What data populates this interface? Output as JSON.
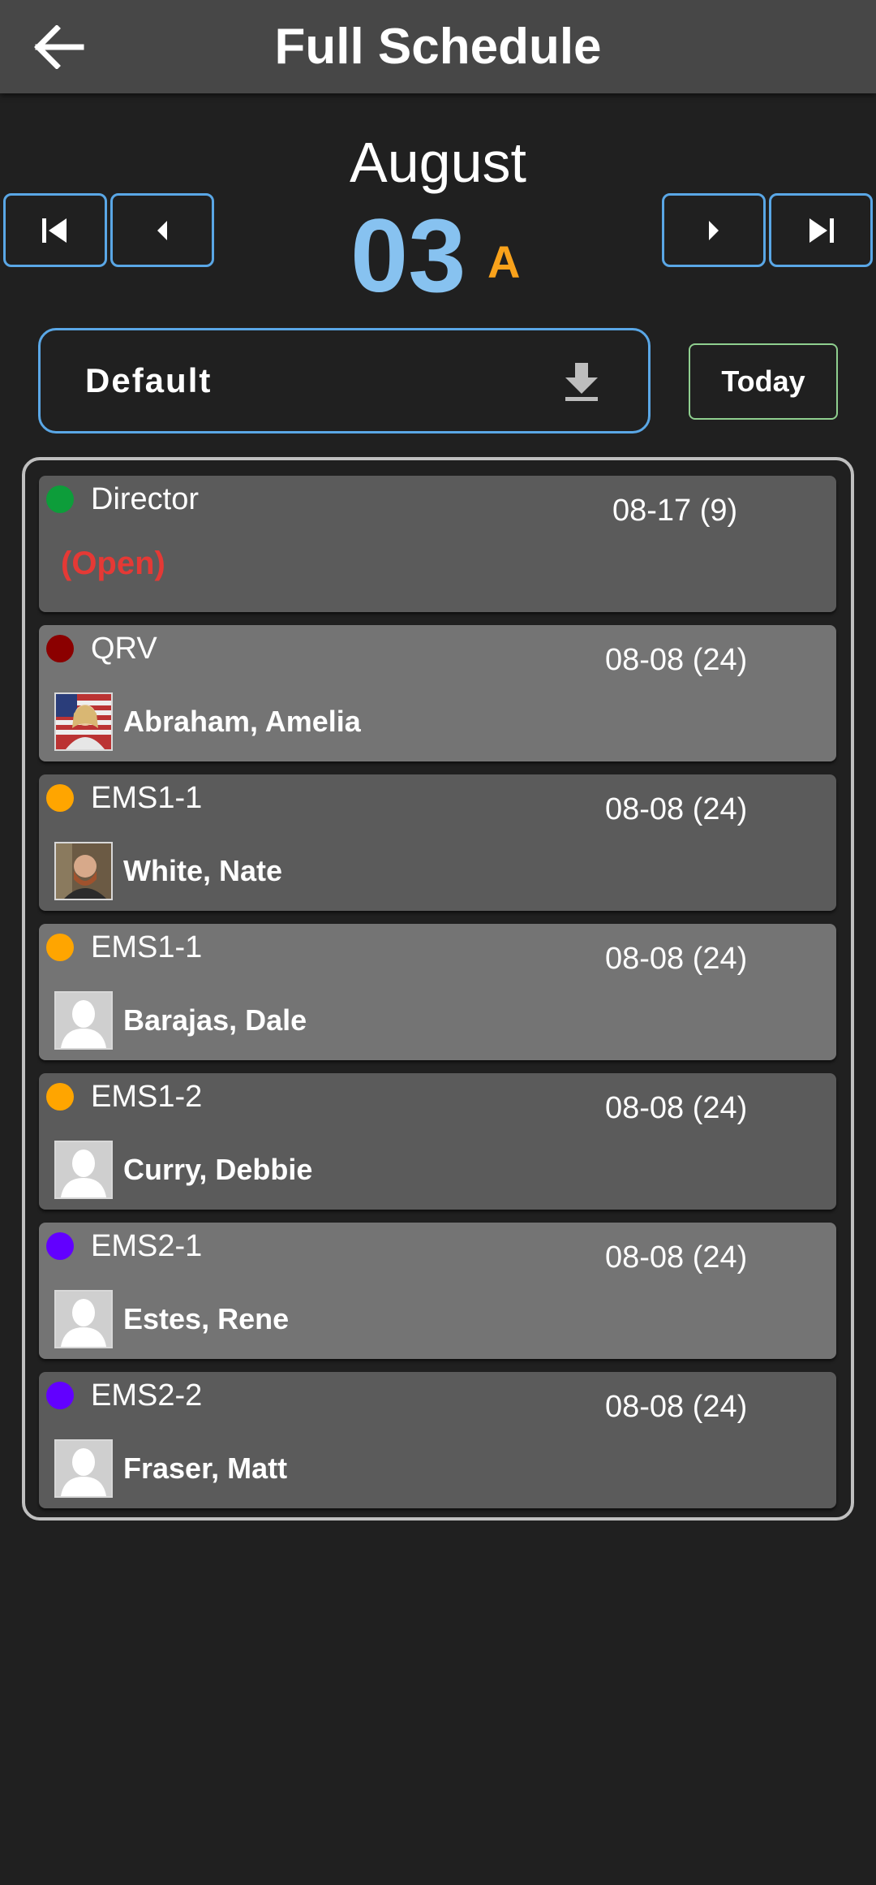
{
  "header": {
    "title": "Full Schedule"
  },
  "date": {
    "month": "August",
    "day": "03",
    "shift_letter": "A"
  },
  "profile": {
    "label": "Default"
  },
  "today_label": "Today",
  "colors": {
    "director": "#0d9d3a",
    "qrv": "#8b0000",
    "ems1": "#ffa500",
    "ems2": "#6200ff"
  },
  "shifts": [
    {
      "position": "Director",
      "time": "08-17 (9)",
      "status": "(Open)",
      "dot_color": "#0d9d3a",
      "avatar": "none"
    },
    {
      "position": "QRV",
      "time": "08-08 (24)",
      "name": "Abraham, Amelia",
      "dot_color": "#8b0000",
      "avatar": "photo-flag"
    },
    {
      "position": "EMS1-1",
      "time": "08-08 (24)",
      "name": "White, Nate",
      "dot_color": "#ffa500",
      "avatar": "photo-man"
    },
    {
      "position": "EMS1-1",
      "time": "08-08 (24)",
      "name": "Barajas, Dale",
      "dot_color": "#ffa500",
      "avatar": "placeholder"
    },
    {
      "position": "EMS1-2",
      "time": "08-08 (24)",
      "name": "Curry, Debbie",
      "dot_color": "#ffa500",
      "avatar": "placeholder"
    },
    {
      "position": "EMS2-1",
      "time": "08-08 (24)",
      "name": "Estes, Rene",
      "dot_color": "#6200ff",
      "avatar": "placeholder"
    },
    {
      "position": "EMS2-2",
      "time": "08-08 (24)",
      "name": "Fraser, Matt",
      "dot_color": "#6200ff",
      "avatar": "placeholder"
    }
  ]
}
